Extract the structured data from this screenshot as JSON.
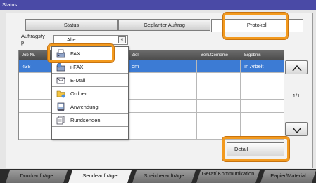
{
  "window": {
    "title": "Status"
  },
  "tabs": [
    {
      "label": "Status"
    },
    {
      "label": "Geplanter Auftrag"
    },
    {
      "label": "Protokoll"
    }
  ],
  "filter": {
    "label": "Auftragsty p",
    "value": "Alle"
  },
  "table": {
    "headers": [
      "Job-Nr.",
      "Ziel",
      "Benutzername",
      "Ergebnis"
    ],
    "rows": [
      {
        "job": "438",
        "dest": "om",
        "user": "",
        "result": "In Arbeit"
      }
    ]
  },
  "dropdown": {
    "items": [
      {
        "label": "FAX",
        "icon": "fax-icon"
      },
      {
        "label": "i-FAX",
        "icon": "ifax-icon"
      },
      {
        "label": "E-Mail",
        "icon": "email-icon"
      },
      {
        "label": "Ordner",
        "icon": "folder-icon"
      },
      {
        "label": "Anwendung",
        "icon": "application-icon"
      },
      {
        "label": "Rundsenden",
        "icon": "broadcast-icon"
      }
    ]
  },
  "pagination": {
    "indicator": "1/1"
  },
  "buttons": {
    "detail": "Detail"
  },
  "bottom_tabs": [
    {
      "label": "Druckaufträge"
    },
    {
      "label": "Sendeaufträge"
    },
    {
      "label": "Speicheraufträge"
    },
    {
      "label": "Gerät/ Kommunikation"
    },
    {
      "label": "Papier/Material"
    }
  ],
  "colors": {
    "title_bar": "#4a4aa6",
    "highlight": "#f39a1e",
    "selected_row": "#3c7bd4"
  }
}
